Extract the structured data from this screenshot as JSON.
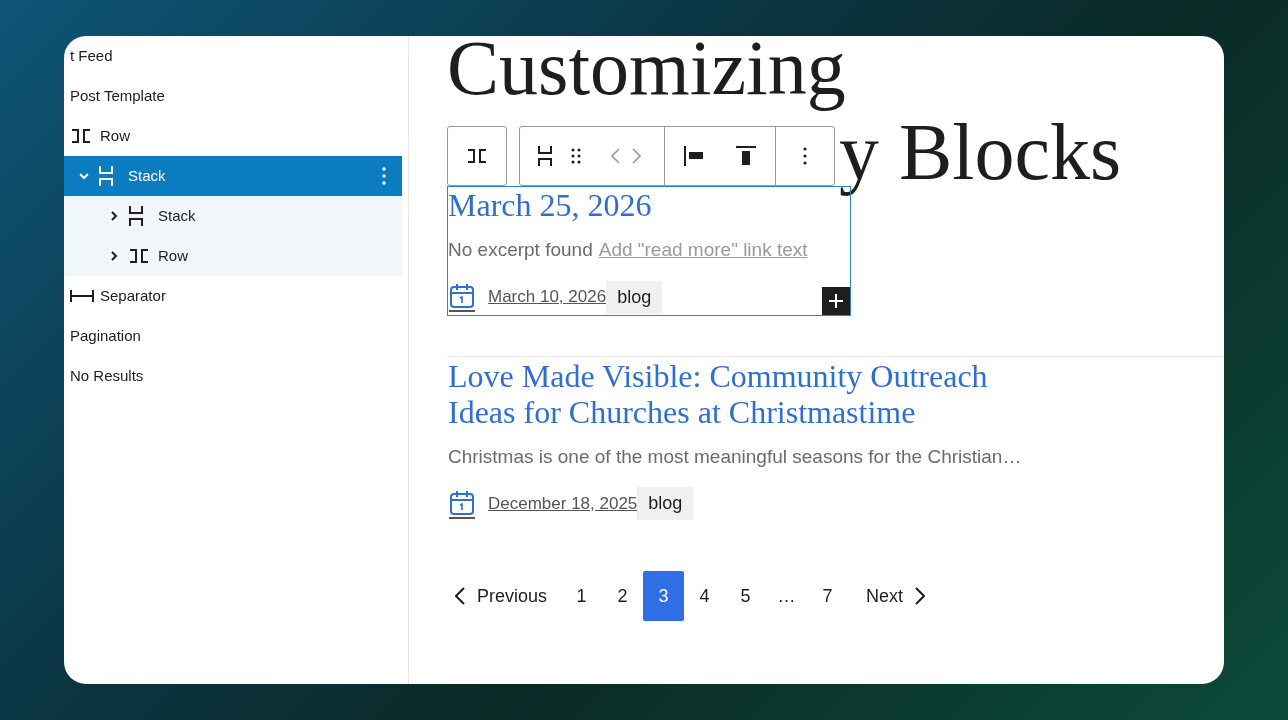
{
  "sidebar": {
    "items": [
      {
        "label": "t Feed",
        "kind": "plain",
        "selected": false
      },
      {
        "label": "Post Template",
        "kind": "plain",
        "selected": false
      },
      {
        "label": "Row",
        "kind": "row",
        "selected": false
      },
      {
        "label": "Stack",
        "kind": "stack",
        "selected": true,
        "expanded": true,
        "children": [
          {
            "label": "Stack",
            "kind": "stack",
            "selected": false,
            "expanded": false
          },
          {
            "label": "Row",
            "kind": "row",
            "selected": false,
            "expanded": false
          }
        ]
      },
      {
        "label": "Separator",
        "kind": "separator",
        "selected": false
      },
      {
        "label": "Pagination",
        "kind": "plain",
        "selected": false
      },
      {
        "label": "No Results",
        "kind": "plain",
        "selected": false
      }
    ]
  },
  "heading": {
    "line_1": "Customizing",
    "line_2_visible": "y Blocks"
  },
  "posts": [
    {
      "title": "March 25, 2026",
      "excerpt": "No excerpt found",
      "read_more": "Add \"read more\" link text",
      "date": "March 10, 2026",
      "tag": "blog",
      "selected": true
    },
    {
      "title": "Love Made Visible: Community Outreach Ideas for Churches at Christmastime",
      "excerpt": "Christmas is one of the most meaningful seasons for the Christian…",
      "date": "December 18, 2025",
      "tag": "blog",
      "selected": false
    }
  ],
  "pagination": {
    "previous": "Previous",
    "next": "Next",
    "pages": [
      {
        "label": "1",
        "selected": false
      },
      {
        "label": "2",
        "selected": false
      },
      {
        "label": "3",
        "selected": true
      },
      {
        "label": "4",
        "selected": false
      },
      {
        "label": "5",
        "selected": false
      },
      {
        "label": "…",
        "selected": false
      },
      {
        "label": "7",
        "selected": false
      }
    ]
  }
}
